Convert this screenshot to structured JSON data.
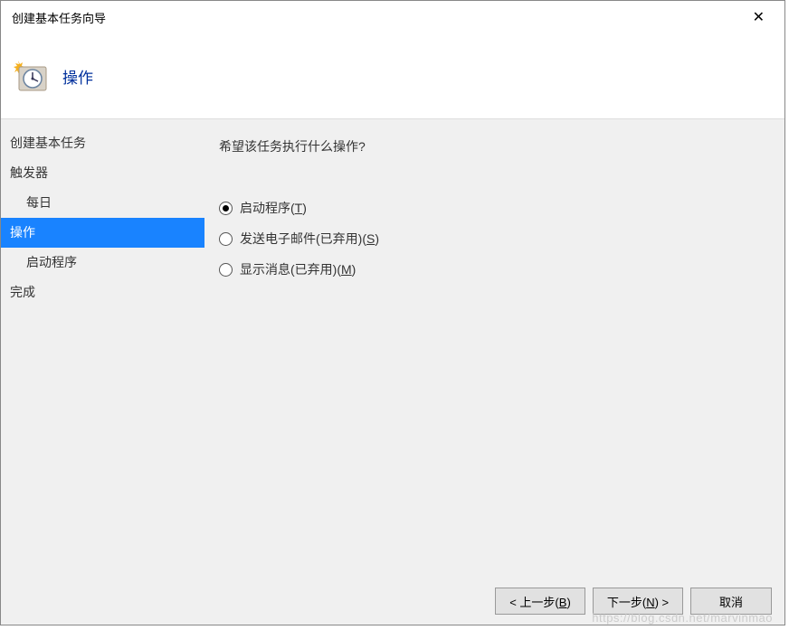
{
  "window": {
    "title": "创建基本任务向导"
  },
  "header": {
    "title": "操作"
  },
  "sidebar": {
    "items": [
      {
        "label": "创建基本任务",
        "indent": false,
        "selected": false
      },
      {
        "label": "触发器",
        "indent": false,
        "selected": false
      },
      {
        "label": "每日",
        "indent": true,
        "selected": false
      },
      {
        "label": "操作",
        "indent": false,
        "selected": true
      },
      {
        "label": "启动程序",
        "indent": true,
        "selected": false
      },
      {
        "label": "完成",
        "indent": false,
        "selected": false
      }
    ]
  },
  "main": {
    "question": "希望该任务执行什么操作?",
    "options": [
      {
        "label_prefix": "启动程序(",
        "mnemonic": "T",
        "label_suffix": ")",
        "checked": true
      },
      {
        "label_prefix": "发送电子邮件(已弃用)(",
        "mnemonic": "S",
        "label_suffix": ")",
        "checked": false
      },
      {
        "label_prefix": "显示消息(已弃用)(",
        "mnemonic": "M",
        "label_suffix": ")",
        "checked": false
      }
    ]
  },
  "buttons": {
    "back_prefix": "< 上一步(",
    "back_mnemonic": "B",
    "back_suffix": ")",
    "next_prefix": "下一步(",
    "next_mnemonic": "N",
    "next_suffix": ") >",
    "cancel": "取消"
  },
  "watermark": "https://blog.csdn.net/marvinmao"
}
